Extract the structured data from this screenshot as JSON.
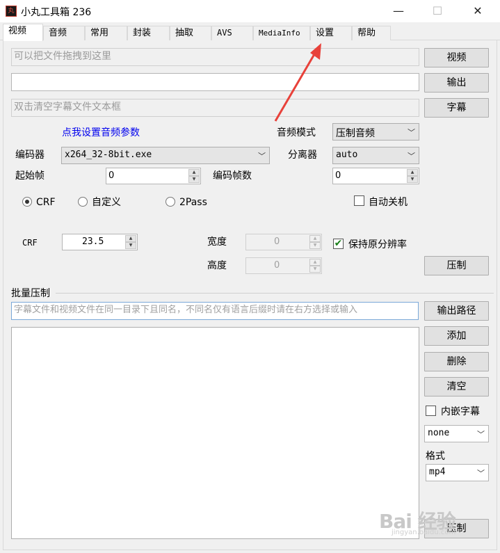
{
  "window": {
    "title": "小丸工具箱 236",
    "minimize": "—",
    "maximize": "☐",
    "close": "✕"
  },
  "tabs": [
    {
      "label": "视频",
      "active": true
    },
    {
      "label": "音频"
    },
    {
      "label": "常用"
    },
    {
      "label": "封装"
    },
    {
      "label": "抽取"
    },
    {
      "label": "AVS"
    },
    {
      "label": "MediaInfo"
    },
    {
      "label": "设置"
    },
    {
      "label": "帮助"
    }
  ],
  "inputs": {
    "video_placeholder": "可以把文件拖拽到这里",
    "output_value": "",
    "subtitle_placeholder": "双击清空字幕文件文本框"
  },
  "buttons": {
    "video": "视频",
    "output": "输出",
    "subtitle": "字幕",
    "compress": "压制",
    "output_path": "输出路径",
    "add": "添加",
    "delete": "删除",
    "clear": "清空",
    "batch_compress": "压制"
  },
  "audio": {
    "link": "点我设置音频参数",
    "mode_label": "音频模式",
    "mode_value": "压制音频"
  },
  "encoder": {
    "label": "编码器",
    "value": "x264_32-8bit.exe",
    "splitter_label": "分离器",
    "splitter_value": "auto"
  },
  "frames": {
    "start_label": "起始帧",
    "start_value": "0",
    "count_label": "编码帧数",
    "count_value": "0"
  },
  "rate_mode": {
    "crf": "CRF",
    "custom": "自定义",
    "twopass": "2Pass",
    "auto_shutdown": "自动关机"
  },
  "crf": {
    "label": "CRF",
    "value": "23.5"
  },
  "resolution": {
    "width_label": "宽度",
    "width_value": "0",
    "height_label": "高度",
    "height_value": "0",
    "keep_label": "保持原分辨率"
  },
  "batch": {
    "title": "批量压制",
    "hint": "字幕文件和视频文件在同一目录下且同名，不同名仅有语言后缀时请在右方选择或输入",
    "embed_sub": "内嵌字幕",
    "sub_lang": "none",
    "format_label": "格式",
    "format_value": "mp4"
  },
  "watermark": {
    "text": "Bai 经验",
    "sub": "jingyan.baidu.com"
  },
  "colors": {
    "link": "#0000ee",
    "annotation": "#e8413a",
    "focus_border": "#7aa8d8"
  }
}
